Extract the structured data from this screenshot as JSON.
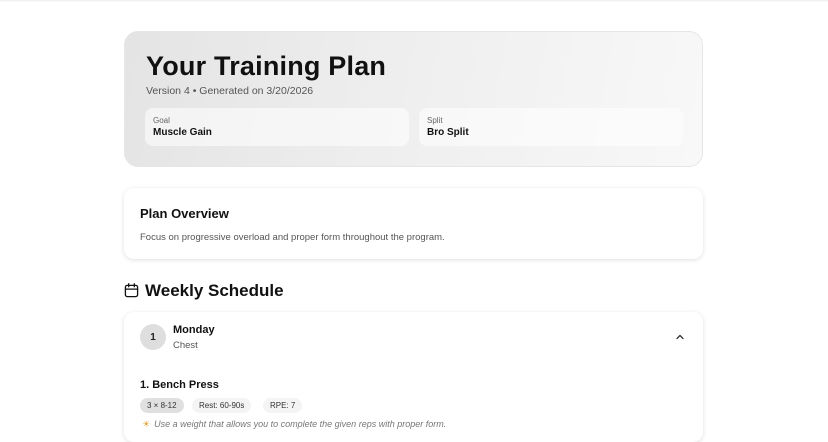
{
  "header": {
    "title": "Your Training Plan",
    "subtitle": "Version 4 • Generated on 3/20/2026",
    "goal": {
      "label": "Goal",
      "value": "Muscle Gain"
    },
    "split": {
      "label": "Split",
      "value": "Bro Split"
    }
  },
  "overview": {
    "title": "Plan Overview",
    "text": "Focus on progressive overload and proper form throughout the program."
  },
  "schedule": {
    "icon": "calendar-icon",
    "title": "Weekly Schedule",
    "days": [
      {
        "number": "1",
        "name": "Monday",
        "focus": "Chest",
        "expanded": true,
        "toggle_icon": "chevron-up-icon",
        "exercises": [
          {
            "title": "1. Bench Press",
            "sets": "3 × 8-12",
            "rest": "Rest: 60-90s",
            "rpe": "RPE: 7",
            "tip_icon": "lightbulb-icon",
            "tip": "Use a weight that allows you to complete the given reps with proper form."
          }
        ]
      }
    ]
  }
}
